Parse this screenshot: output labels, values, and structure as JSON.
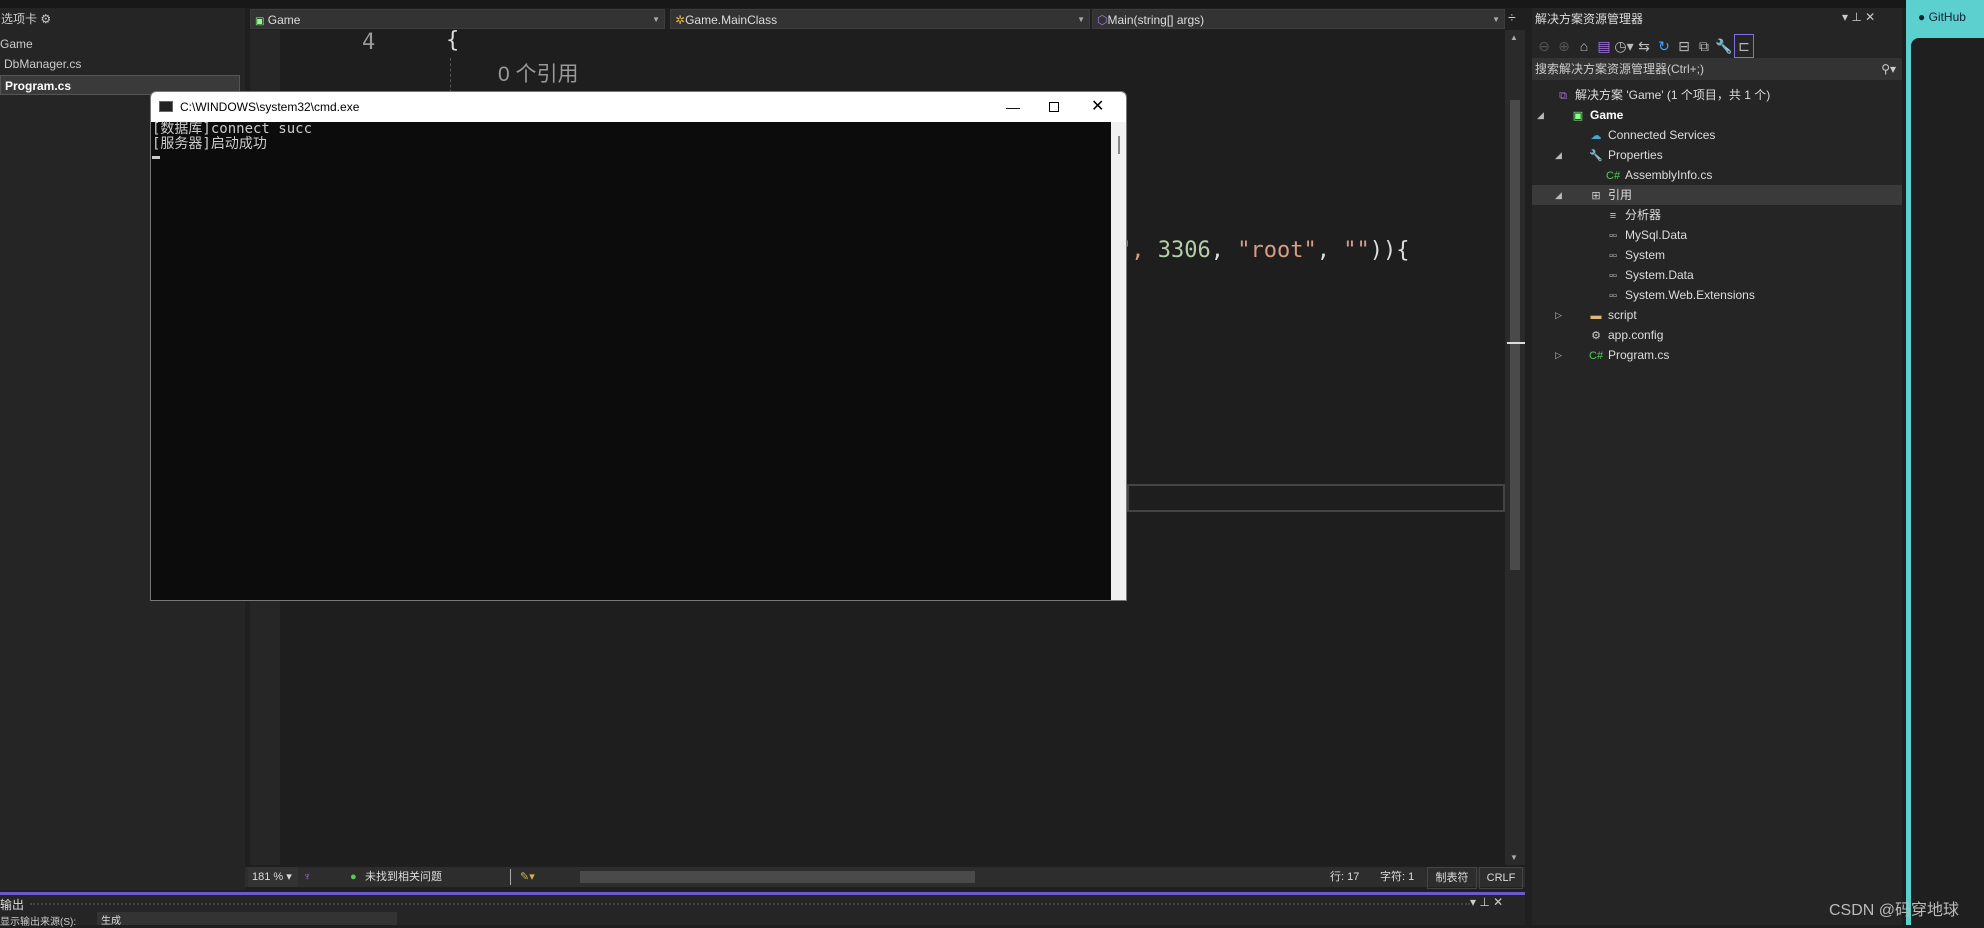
{
  "left_panel": {
    "header": "选项卡",
    "gear_icon": "gear-icon",
    "items": [
      {
        "label": "Game"
      },
      {
        "label": "DbManager.cs"
      },
      {
        "label": "Program.cs",
        "selected": true
      }
    ]
  },
  "navbar": {
    "project": "Game",
    "class": "Game.MainClass",
    "member": "Main(string[] args)"
  },
  "editor": {
    "line_number": "4",
    "brace": "{",
    "codelens": "0 个引用",
    "code": {
      "p1": "\", ",
      "num": "3306",
      "p2": ", ",
      "str1": "\"root\"",
      "p3": ", ",
      "str2": "\"\"",
      "p4": ")){"
    }
  },
  "cmd": {
    "title": "C:\\WINDOWS\\system32\\cmd.exe",
    "lines": [
      "[数据库]connect succ",
      "[服务器]启动成功"
    ],
    "cursor": "_"
  },
  "status": {
    "zoom": "181 %",
    "issues": "未找到相关问题",
    "line": "行: 17",
    "char": "字符: 1",
    "tab": "制表符",
    "eol": "CRLF"
  },
  "output": {
    "title": "输出",
    "source_label": "显示输出来源(S):",
    "source_value": "生成"
  },
  "solution_explorer": {
    "title": "解决方案资源管理器",
    "search_placeholder": "搜索解决方案资源管理器(Ctrl+;)",
    "tree": [
      {
        "label": "解决方案 'Game' (1 个项目，共 1 个)",
        "icon": "solution-icon",
        "level": 0
      },
      {
        "label": "Game",
        "icon": "csharp-project-icon",
        "level": 1,
        "expanded": true,
        "bold": true
      },
      {
        "label": "Connected Services",
        "icon": "connected-services-icon",
        "level": 2
      },
      {
        "label": "Properties",
        "icon": "wrench-icon",
        "level": 2,
        "expanded": true
      },
      {
        "label": "AssemblyInfo.cs",
        "icon": "csharp-file-icon",
        "level": 3
      },
      {
        "label": "引用",
        "icon": "references-icon",
        "level": 2,
        "expanded": true,
        "highlighted": true
      },
      {
        "label": "分析器",
        "icon": "analyzer-icon",
        "level": 3
      },
      {
        "label": "MySql.Data",
        "icon": "reference-icon",
        "level": 3
      },
      {
        "label": "System",
        "icon": "reference-icon",
        "level": 3
      },
      {
        "label": "System.Data",
        "icon": "reference-icon",
        "level": 3
      },
      {
        "label": "System.Web.Extensions",
        "icon": "reference-icon",
        "level": 3
      },
      {
        "label": "script",
        "icon": "folder-icon",
        "level": 2,
        "collapsed": true
      },
      {
        "label": "app.config",
        "icon": "config-icon",
        "level": 2
      },
      {
        "label": "Program.cs",
        "icon": "csharp-file-icon",
        "level": 2,
        "collapsed": true
      }
    ]
  },
  "github_tab": {
    "label": "GitHub"
  },
  "watermark": "CSDN @码穿地球",
  "colors": {
    "accent": "#6a5acd",
    "github": "#5ccfcf",
    "string": "#d69d85",
    "number": "#b5cea8"
  }
}
